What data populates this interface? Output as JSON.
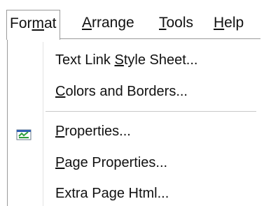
{
  "menubar": {
    "items": [
      {
        "pre": "For",
        "mnemonic": "m",
        "post": "at"
      },
      {
        "pre": "",
        "mnemonic": "A",
        "post": "rrange"
      },
      {
        "pre": "",
        "mnemonic": "T",
        "post": "ools"
      },
      {
        "pre": "",
        "mnemonic": "H",
        "post": "elp"
      }
    ]
  },
  "format_menu": {
    "items": [
      {
        "pre": "Text Link ",
        "mnemonic": "S",
        "post": "tyle Sheet...",
        "icon": ""
      },
      {
        "pre": "",
        "mnemonic": "C",
        "post": "olors and Borders...",
        "icon": ""
      },
      {
        "pre": "",
        "mnemonic": "P",
        "post": "roperties...",
        "icon": "properties-icon"
      },
      {
        "pre": "",
        "mnemonic": "P",
        "post": "age Properties...",
        "icon": ""
      },
      {
        "pre": "Extra Page Html...",
        "mnemonic": "",
        "post": "",
        "icon": ""
      }
    ]
  },
  "colors": {
    "border": "#9a9a9a",
    "separator": "#c8c8c8",
    "icon_green": "#2e9e3c",
    "icon_blue": "#2f5fb3"
  }
}
